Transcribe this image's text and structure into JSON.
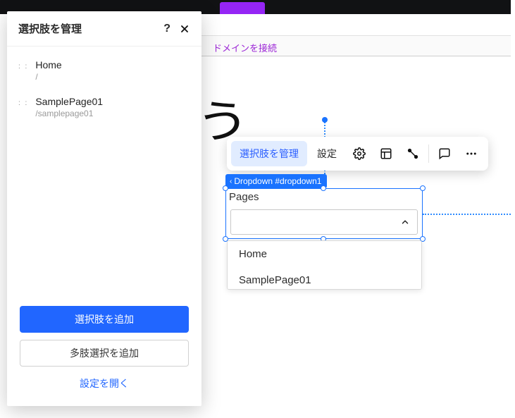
{
  "topbar": {
    "connect_domain": "ドメインを接続"
  },
  "panel": {
    "title": "選択肢を管理",
    "items": [
      {
        "label": "Home",
        "path": "/"
      },
      {
        "label": "SamplePage01",
        "path": "/samplepage01"
      }
    ],
    "primary_btn": "選択肢を追加",
    "secondary_btn": "多肢選択を追加",
    "link_btn": "設定を開く"
  },
  "toolbar": {
    "manage_label": "選択肢を管理",
    "settings_label": "設定"
  },
  "element_tag": {
    "name": "Dropdown #dropdown1"
  },
  "dropdown": {
    "label": "Pages",
    "options": [
      "Home",
      "SamplePage01"
    ]
  }
}
